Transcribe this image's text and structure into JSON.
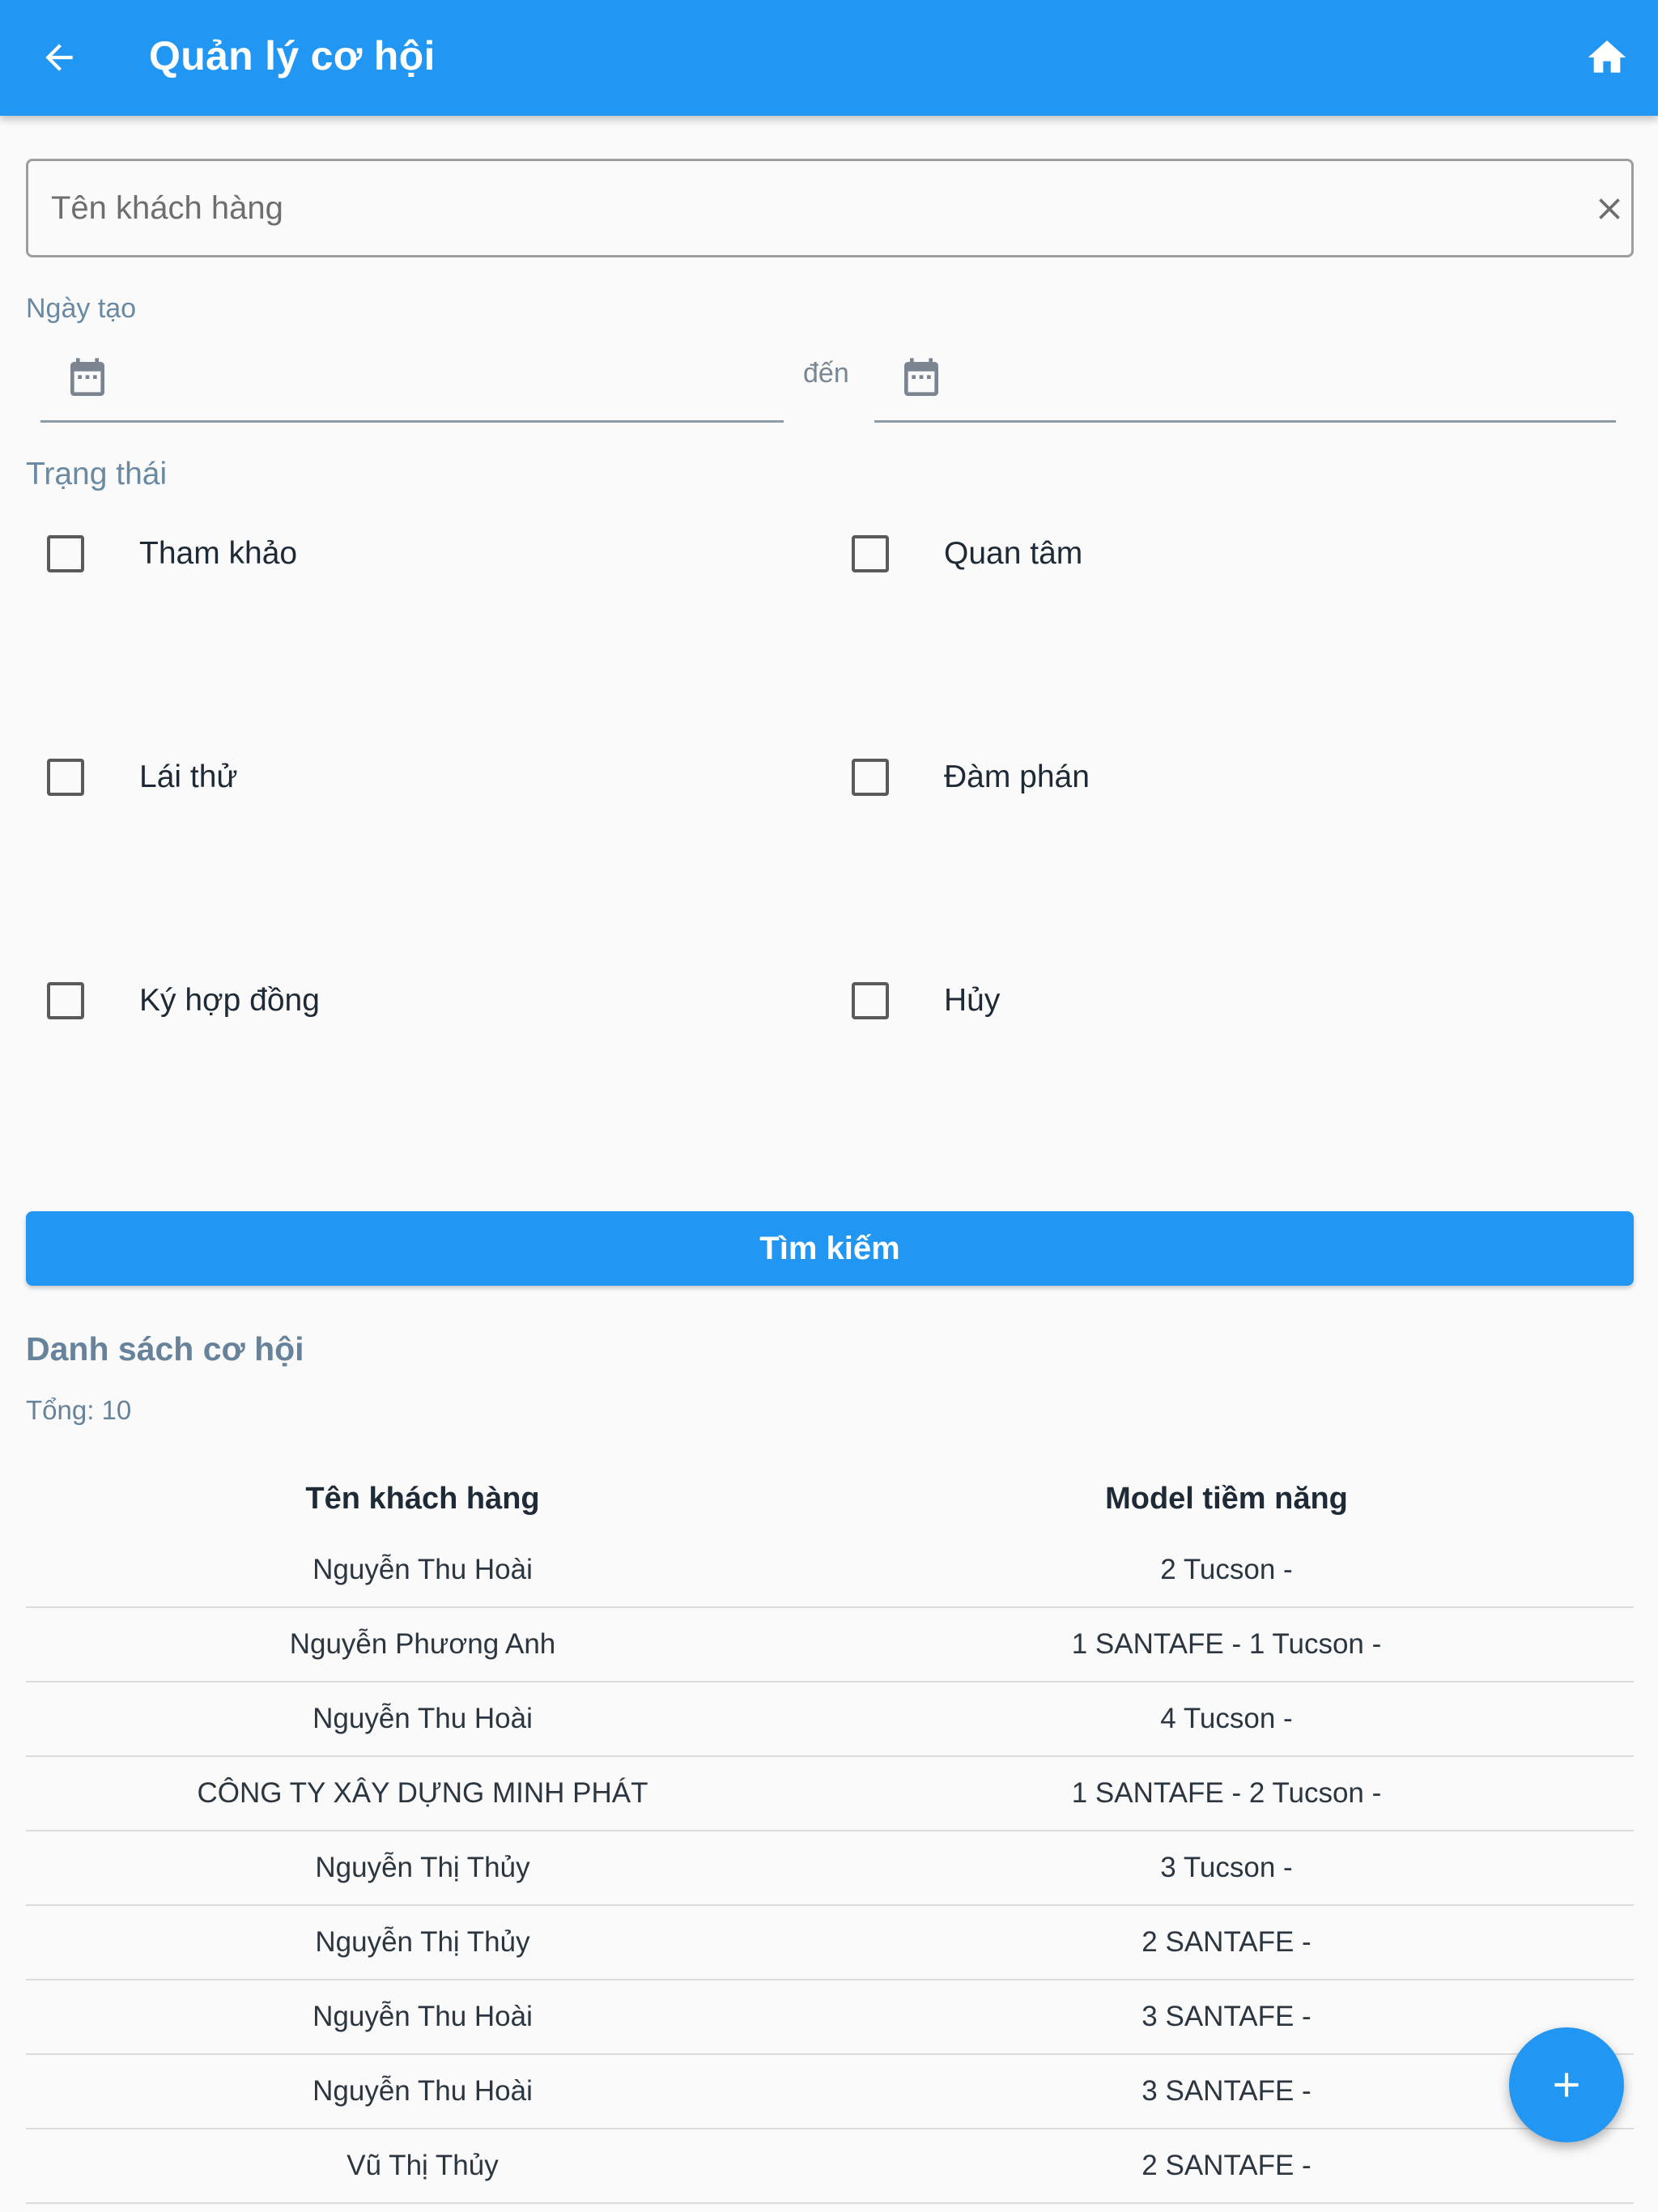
{
  "appbar": {
    "title": "Quản lý cơ hội"
  },
  "search": {
    "placeholder": "Tên khách hàng",
    "value": ""
  },
  "date_filter": {
    "label": "Ngày tạo",
    "to_label": "đến",
    "from_value": "",
    "to_value": ""
  },
  "status_filter": {
    "label": "Trạng thái",
    "options": [
      {
        "label": "Tham khảo",
        "checked": false
      },
      {
        "label": "Quan tâm",
        "checked": false
      },
      {
        "label": "Lái thử",
        "checked": false
      },
      {
        "label": "Đàm phán",
        "checked": false
      },
      {
        "label": "Ký hợp đồng",
        "checked": false
      },
      {
        "label": "Hủy",
        "checked": false
      }
    ]
  },
  "search_button": {
    "label": "Tìm kiếm"
  },
  "opportunity_list": {
    "title": "Danh sách cơ hội",
    "total": "Tổng: 10",
    "columns": [
      "Tên khách hàng",
      "Model tiềm năng"
    ],
    "rows": [
      {
        "customer": "Nguyễn Thu Hoài",
        "model": "2 Tucson -"
      },
      {
        "customer": "Nguyễn Phương Anh",
        "model": "1 SANTAFE - 1 Tucson -"
      },
      {
        "customer": "Nguyễn Thu Hoài",
        "model": "4 Tucson -"
      },
      {
        "customer": "CÔNG TY XÂY DỰNG MINH PHÁT",
        "model": "1 SANTAFE - 2 Tucson -"
      },
      {
        "customer": "Nguyễn Thị Thủy",
        "model": "3 Tucson -"
      },
      {
        "customer": "Nguyễn Thị Thủy",
        "model": "2 SANTAFE -"
      },
      {
        "customer": "Nguyễn Thu Hoài",
        "model": "3 SANTAFE -"
      },
      {
        "customer": "Nguyễn Thu Hoài",
        "model": "3 SANTAFE -"
      },
      {
        "customer": "Vũ Thị Thủy",
        "model": "2 SANTAFE -"
      }
    ]
  },
  "icons": {
    "back": "arrow-left-icon",
    "home": "home-icon",
    "clear": "close-icon",
    "calendar": "calendar-icon",
    "fab": "plus-icon"
  },
  "colors": {
    "primary": "#2196f3",
    "section_label": "#6a8aa3",
    "background": "#fafafa"
  }
}
